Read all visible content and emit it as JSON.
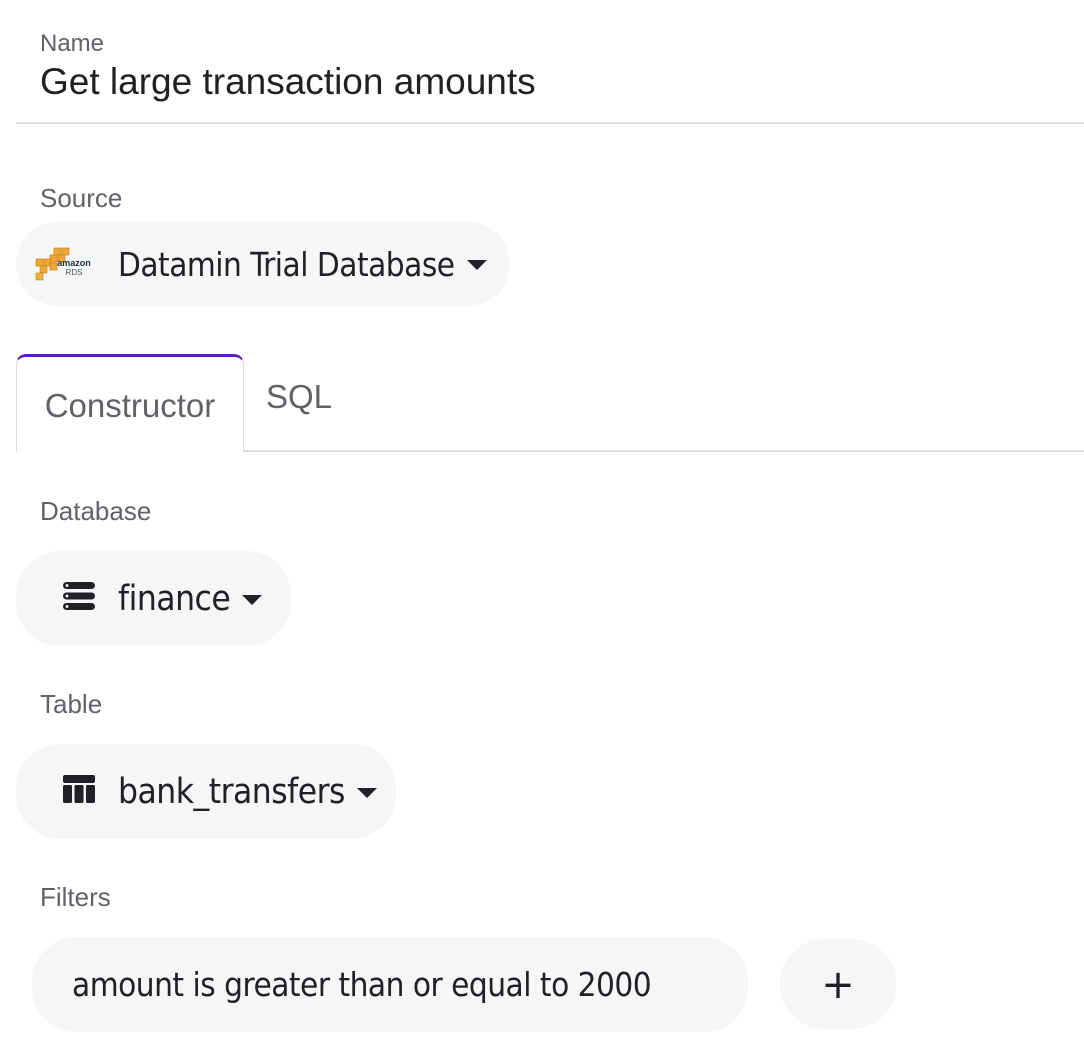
{
  "name": {
    "label": "Name",
    "value": "Get large transaction amounts"
  },
  "source": {
    "label": "Source",
    "logo_top": "amazon",
    "logo_bottom": "RDS",
    "selected": "Datamin Trial Database",
    "icon": "amazon-rds-icon"
  },
  "tabs": [
    {
      "label": "Constructor",
      "active": true
    },
    {
      "label": "SQL",
      "active": false
    }
  ],
  "database": {
    "label": "Database",
    "selected": "finance",
    "icon": "database-icon"
  },
  "table": {
    "label": "Table",
    "selected": "bank_transfers",
    "icon": "table-icon"
  },
  "filters": {
    "label": "Filters",
    "items": [
      "amount is greater than or equal to 2000"
    ],
    "add_label": "+"
  },
  "colors": {
    "accent": "#5b21b6",
    "pill_bg": "#f5f6f8",
    "label": "#5f6368",
    "aws_orange": "#f0a830"
  }
}
